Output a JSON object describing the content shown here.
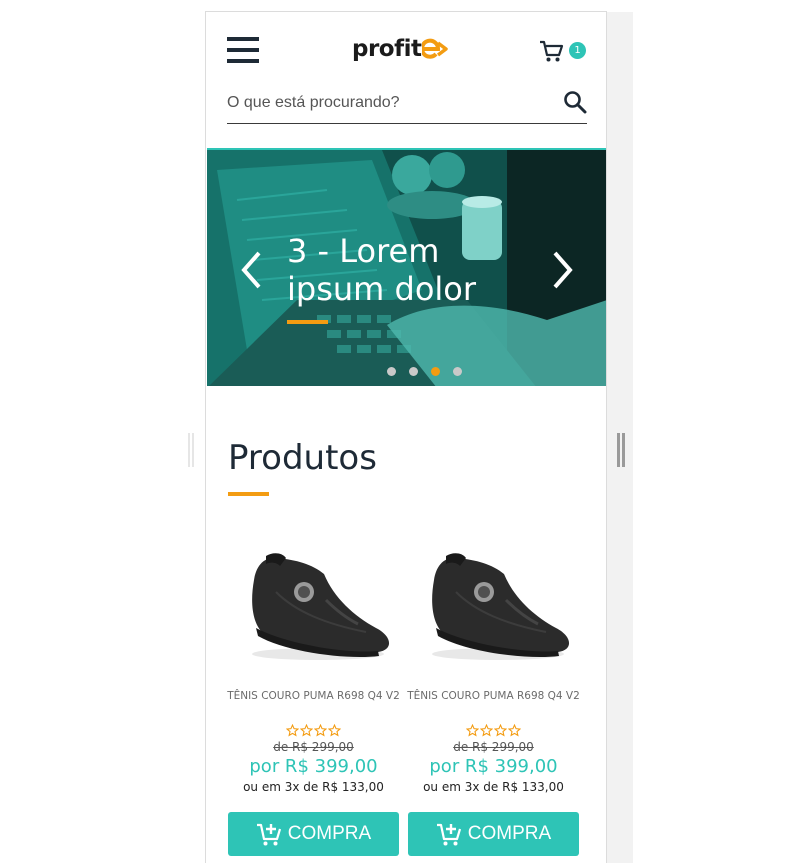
{
  "header": {
    "logo_text": "profit",
    "cart_count": "1",
    "colors": {
      "accent": "#2ec4b6",
      "highlight": "#f39c12",
      "dark": "#1e2a36"
    }
  },
  "search": {
    "placeholder": "O que está procurando?"
  },
  "hero": {
    "title": "3 - Lorem ipsum dolor",
    "slides": 4,
    "active_slide": 3
  },
  "section": {
    "title": "Produtos"
  },
  "products": [
    {
      "name": "TÊNIS COURO PUMA R698 Q4 V2",
      "rating": 0,
      "old_price": "de R$ 299,00",
      "price": "por R$ 399,00",
      "installments": "ou em 3x de R$ 133,00",
      "button_label": "COMPRA"
    },
    {
      "name": "TÊNIS COURO PUMA R698 Q4 V2",
      "rating": 0,
      "old_price": "de R$ 299,00",
      "price": "por R$ 399,00",
      "installments": "ou em 3x de R$ 133,00",
      "button_label": "COMPRA"
    }
  ]
}
